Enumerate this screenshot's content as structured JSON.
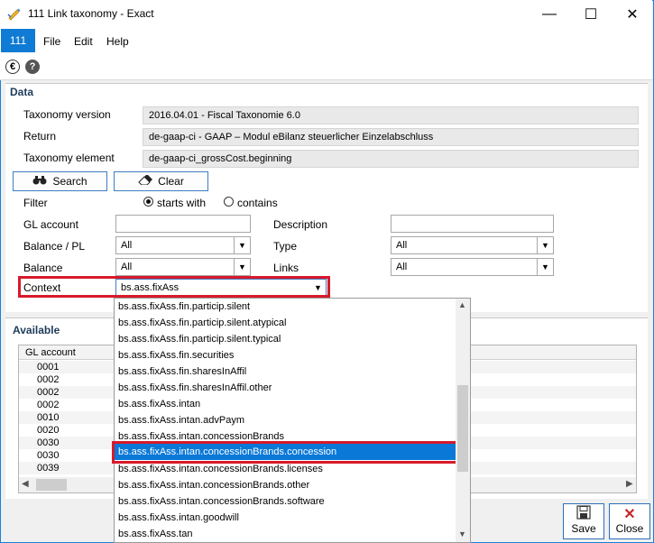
{
  "window": {
    "title": "111 Link taxonomy - Exact",
    "minimize": "—",
    "maximize": "☐",
    "close": "✕"
  },
  "menubar": {
    "app_badge": "111",
    "items": [
      {
        "label": "File"
      },
      {
        "label": "Edit"
      },
      {
        "label": "Help"
      }
    ]
  },
  "toolbar": {
    "euro_icon": "€",
    "help_icon": "?"
  },
  "data_section": {
    "title": "Data",
    "taxonomy_version_label": "Taxonomy version",
    "taxonomy_version_value": "2016.04.01 - Fiscal Taxonomie 6.0",
    "return_label": "Return",
    "return_value": "de-gaap-ci - GAAP – Modul eBilanz steuerlicher Einzelabschluss",
    "taxonomy_element_label": "Taxonomy element",
    "taxonomy_element_value": "de-gaap-ci_grossCost.beginning",
    "search_button": "Search",
    "clear_button": "Clear",
    "filter_label": "Filter",
    "filter_starts_with": "starts with",
    "filter_contains": "contains",
    "gl_account_label": "GL account",
    "gl_account_value": "",
    "description_label": "Description",
    "description_value": "",
    "balance_pl_label": "Balance / PL",
    "balance_pl_value": "All",
    "type_label": "Type",
    "type_value": "All",
    "balance_label": "Balance",
    "balance_value": "All",
    "links_label": "Links",
    "links_value": "All",
    "context_label": "Context",
    "context_value": "bs.ass.fixAss"
  },
  "available_section": {
    "title": "Available",
    "column_gl_account": "GL account",
    "rows": [
      "0001",
      "0002",
      "0002",
      "0002",
      "0010",
      "0020",
      "0030",
      "0030",
      "0039"
    ]
  },
  "context_dropdown": {
    "options": [
      "bs.ass.fixAss.fin.particip.silent",
      "bs.ass.fixAss.fin.particip.silent.atypical",
      "bs.ass.fixAss.fin.particip.silent.typical",
      "bs.ass.fixAss.fin.securities",
      "bs.ass.fixAss.fin.sharesInAffil",
      "bs.ass.fixAss.fin.sharesInAffil.other",
      "bs.ass.fixAss.intan",
      "bs.ass.fixAss.intan.advPaym",
      "bs.ass.fixAss.intan.concessionBrands",
      "bs.ass.fixAss.intan.concessionBrands.concession",
      "bs.ass.fixAss.intan.concessionBrands.licenses",
      "bs.ass.fixAss.intan.concessionBrands.other",
      "bs.ass.fixAss.intan.concessionBrands.software",
      "bs.ass.fixAss.intan.goodwill",
      "bs.ass.fixAss.tan"
    ],
    "selected": "bs.ass.fixAss.intan.concessionBrands.concession"
  },
  "footer": {
    "save_button": "Save",
    "close_button": "Close"
  },
  "colors": {
    "accent": "#0f7bd4",
    "selection": "#0a78d7",
    "highlight_frame": "#d71a2a"
  }
}
